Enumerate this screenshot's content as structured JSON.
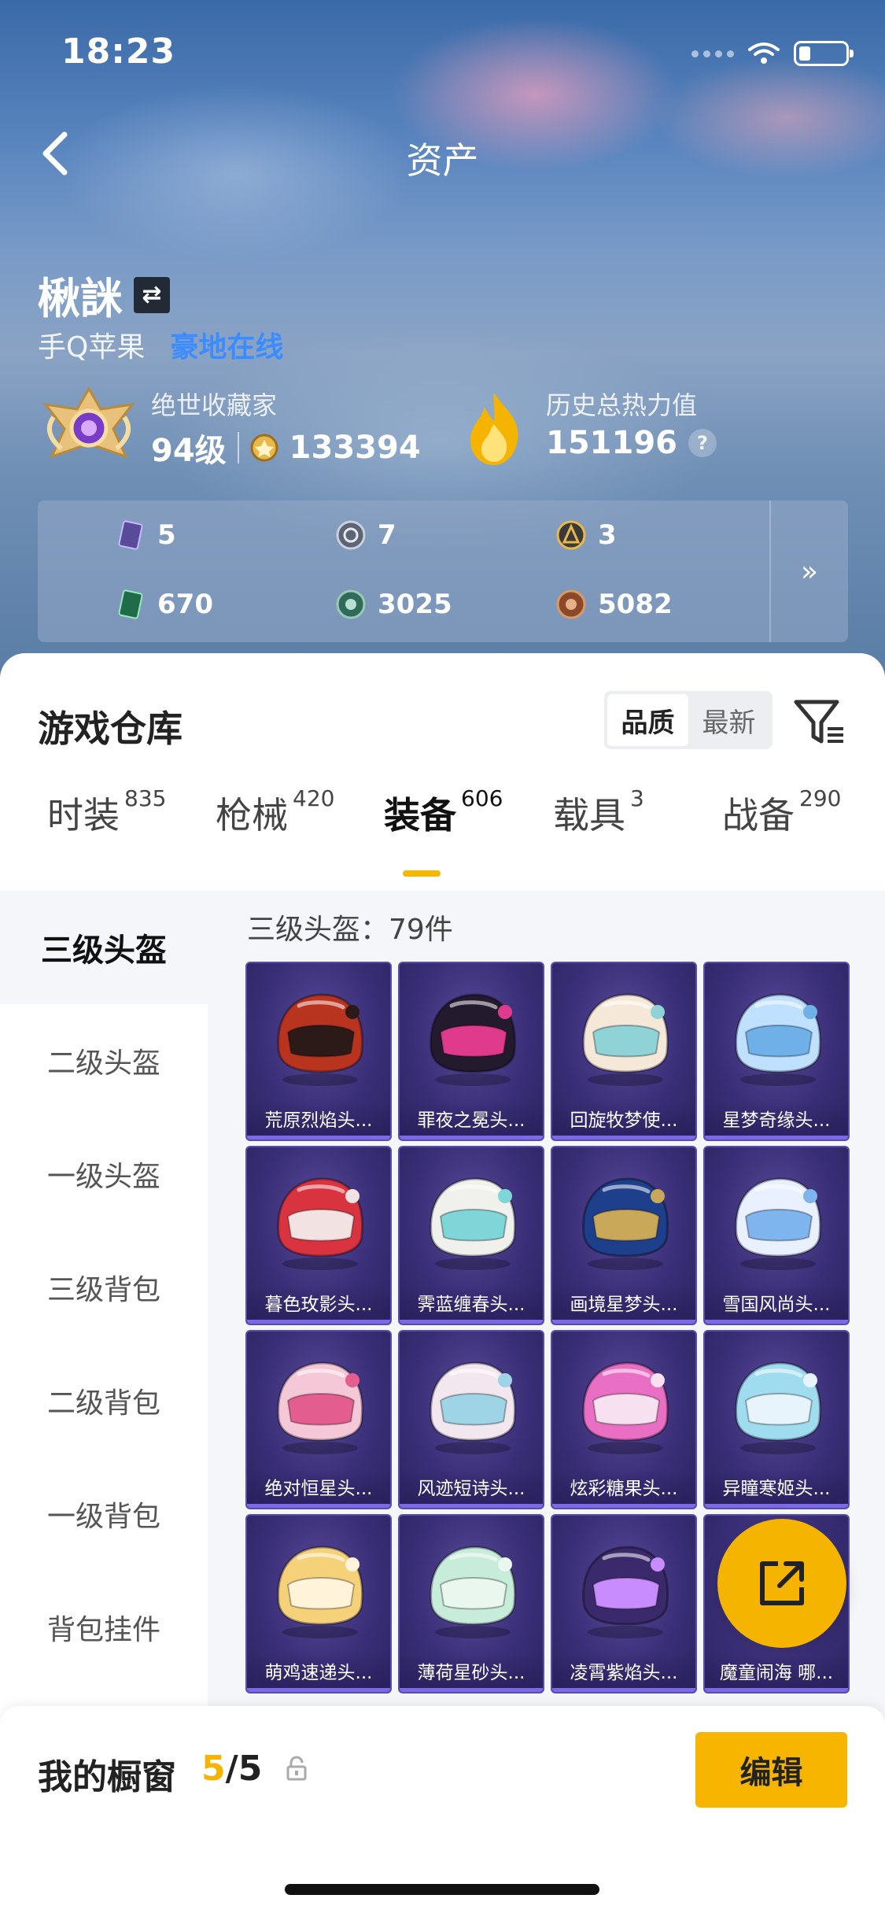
{
  "status": {
    "time": "18:23"
  },
  "nav": {
    "title": "资产"
  },
  "profile": {
    "username": "楸詸",
    "platform": "手Q苹果",
    "online_status": "豪地在线",
    "collector_title": "绝世收藏家",
    "level": "94级",
    "coins": "133394",
    "heat_title": "历史总热力值",
    "heat_value": "151196",
    "help": "?"
  },
  "currencies": [
    {
      "icon": "purple-card-icon",
      "value": "5"
    },
    {
      "icon": "silver-coin-icon",
      "value": "7"
    },
    {
      "icon": "gold-coin-icon",
      "value": "3"
    },
    {
      "icon": "green-card-icon",
      "value": "670"
    },
    {
      "icon": "green-coin-icon",
      "value": "3025"
    },
    {
      "icon": "bronze-coin-icon",
      "value": "5082"
    }
  ],
  "expand_label": "»",
  "warehouse": {
    "title": "游戏仓库",
    "sort_options": [
      "品质",
      "最新"
    ],
    "tabs": [
      {
        "label": "时装",
        "count": "835"
      },
      {
        "label": "枪械",
        "count": "420"
      },
      {
        "label": "装备",
        "count": "606"
      },
      {
        "label": "载具",
        "count": "3"
      },
      {
        "label": "战备",
        "count": "290"
      }
    ],
    "categories": [
      "三级头盔",
      "二级头盔",
      "一级头盔",
      "三级背包",
      "二级背包",
      "一级背包",
      "背包挂件"
    ],
    "count_label": "三级头盔：79件",
    "items": [
      {
        "name": "荒原烈焰头...",
        "palette": [
          "#b8341f",
          "#2b1a18"
        ]
      },
      {
        "name": "罪夜之冕头...",
        "palette": [
          "#241a2e",
          "#e03a8c"
        ]
      },
      {
        "name": "回旋牧梦使...",
        "palette": [
          "#f6e8d8",
          "#8fd3d6"
        ]
      },
      {
        "name": "星梦奇缘头...",
        "palette": [
          "#bfe0ff",
          "#6fb0e8"
        ]
      },
      {
        "name": "暮色玫影头...",
        "palette": [
          "#d8333f",
          "#f2e2e2"
        ]
      },
      {
        "name": "霁蓝缠春头...",
        "palette": [
          "#f0f0ec",
          "#7fd6d9"
        ]
      },
      {
        "name": "画境星梦头...",
        "palette": [
          "#1d3f8c",
          "#c9a85a"
        ]
      },
      {
        "name": "雪国风尚头...",
        "palette": [
          "#e9f0ff",
          "#7fb5ef"
        ]
      },
      {
        "name": "绝对恒星头...",
        "palette": [
          "#f4c8d7",
          "#e35d8e"
        ]
      },
      {
        "name": "风迹短诗头...",
        "palette": [
          "#f3e7ef",
          "#9fd4e6"
        ]
      },
      {
        "name": "炫彩糖果头...",
        "palette": [
          "#e86fc4",
          "#f7e1f0"
        ]
      },
      {
        "name": "异瞳寒姬头...",
        "palette": [
          "#9fdcf0",
          "#e8f4fb"
        ]
      },
      {
        "name": "萌鸡速递头...",
        "palette": [
          "#f5d27a",
          "#fff3d9"
        ]
      },
      {
        "name": "薄荷星砂头...",
        "palette": [
          "#c7ecd9",
          "#e9f7ef"
        ]
      },
      {
        "name": "凌霄紫焰头...",
        "palette": [
          "#3b2a6b",
          "#c98cff"
        ]
      },
      {
        "name": "魔童闹海 哪...",
        "palette": [
          "#d9583a",
          "#f2c25a"
        ]
      }
    ]
  },
  "showcase": {
    "label": "我的橱窗",
    "current": "5",
    "total": "/5",
    "edit_label": "编辑"
  },
  "colors": {
    "accent": "#f5b400",
    "online": "#3b8cff",
    "card_bg": "#3a2f78"
  }
}
